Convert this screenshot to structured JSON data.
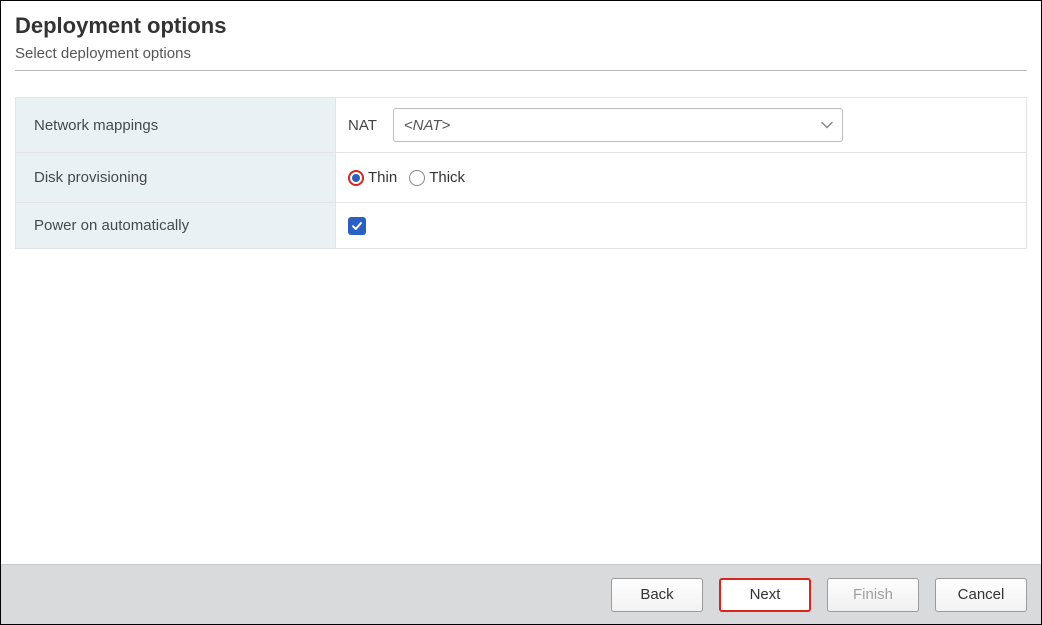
{
  "header": {
    "title": "Deployment options",
    "subtitle": "Select deployment options"
  },
  "form": {
    "network_mappings": {
      "label": "Network mappings",
      "field_label": "NAT",
      "selected_value": "<NAT>"
    },
    "disk_provisioning": {
      "label": "Disk provisioning",
      "options": {
        "thin": "Thin",
        "thick": "Thick"
      },
      "selected": "thin"
    },
    "power_on": {
      "label": "Power on automatically",
      "checked": true
    }
  },
  "footer": {
    "back": "Back",
    "next": "Next",
    "finish": "Finish",
    "cancel": "Cancel"
  }
}
